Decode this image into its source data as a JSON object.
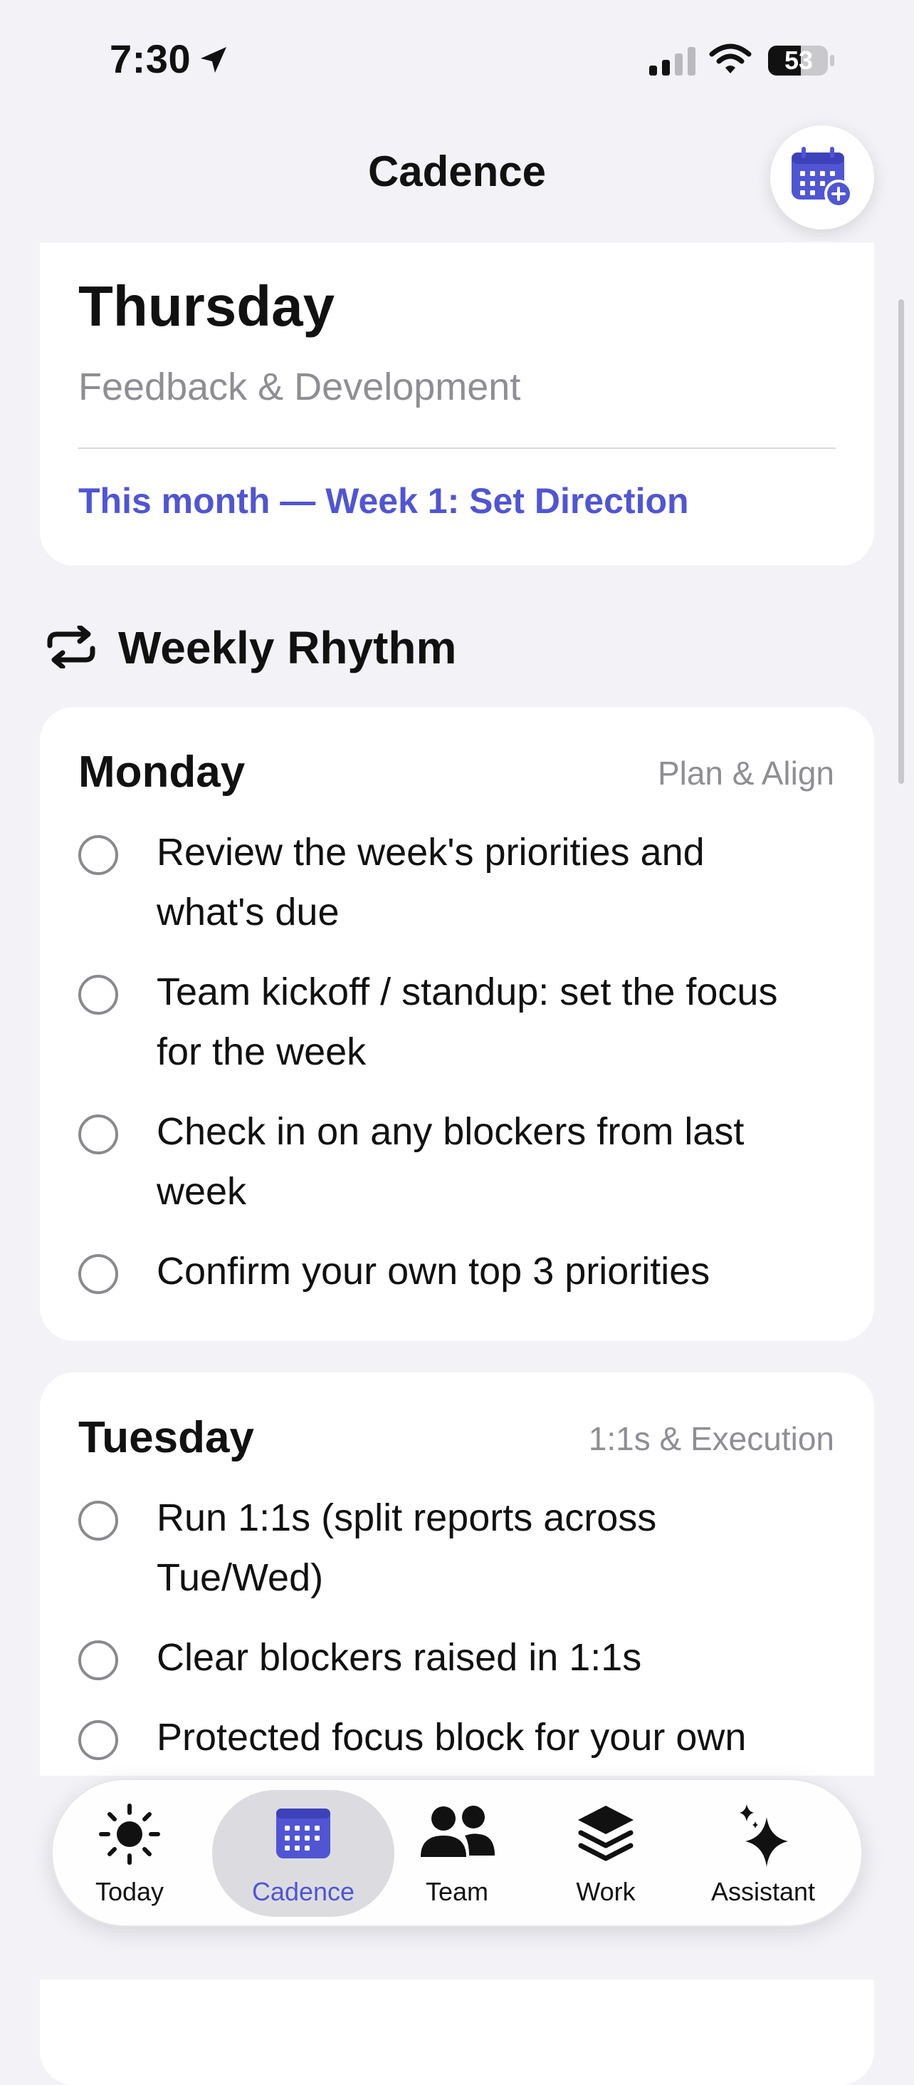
{
  "status_bar": {
    "time": "7:30",
    "battery": "53"
  },
  "header": {
    "title": "Cadence",
    "add_button_icon": "calendar-add-icon"
  },
  "today_card": {
    "day": "Thursday",
    "theme": "Feedback & Development",
    "month_link": "This month — Week 1: Set Direction"
  },
  "section": {
    "icon": "repeat-icon",
    "title": "Weekly Rhythm"
  },
  "days": [
    {
      "name": "Monday",
      "theme": "Plan & Align",
      "tasks": [
        "Review the week's priorities and what's due",
        "Team kickoff / standup: set the focus for the week",
        "Check in on any blockers from last week",
        "Confirm your own top 3 priorities"
      ]
    },
    {
      "name": "Tuesday",
      "theme": "1:1s & Execution",
      "tasks": [
        "Run 1:1s (split reports across Tue/Wed)",
        "Clear blockers raised in 1:1s",
        "Protected focus block for your own"
      ]
    }
  ],
  "tabbar": {
    "tabs": [
      {
        "label": "Today",
        "icon": "sun-icon"
      },
      {
        "label": "Cadence",
        "icon": "calendar-icon"
      },
      {
        "label": "Team",
        "icon": "people-icon"
      },
      {
        "label": "Work",
        "icon": "stack-icon"
      },
      {
        "label": "Assistant",
        "icon": "sparkles-icon"
      }
    ],
    "active": "Cadence"
  },
  "colors": {
    "accent": "#5055d4",
    "background": "#f2f2f7",
    "card": "#ffffff",
    "secondary_text": "#8e8e93"
  }
}
